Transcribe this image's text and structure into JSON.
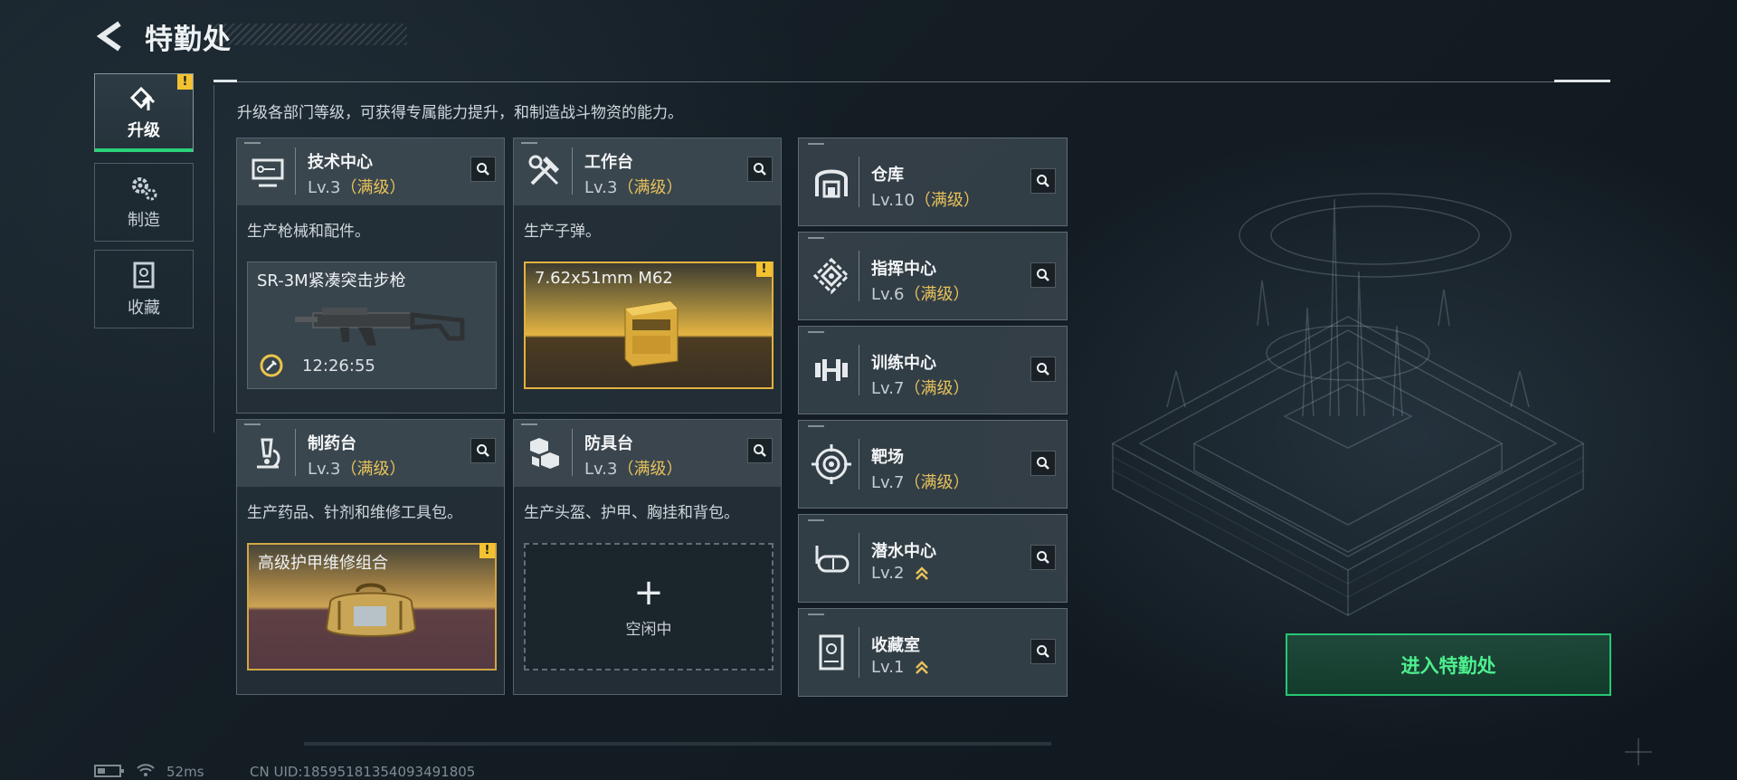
{
  "header": {
    "title": "特勤处"
  },
  "sidebar": {
    "tabs": [
      {
        "label": "升级",
        "icon": "upgrade-icon",
        "active": true,
        "alert": "!"
      },
      {
        "label": "制造",
        "icon": "gears-icon",
        "active": false
      },
      {
        "label": "收藏",
        "icon": "collection-icon",
        "active": false
      }
    ]
  },
  "description": "升级各部门等级，可获得专属能力提升，和制造战斗物资的能力。",
  "workshops": [
    {
      "name": "技术中心",
      "level": "Lv.3",
      "status": "（满级）",
      "desc": "生产枪械和配件。",
      "icon": "monitor-icon",
      "slot": {
        "item": "SR-3M紧凑突击步枪",
        "timer": "12:26:55",
        "icon": "timer-icon"
      }
    },
    {
      "name": "工作台",
      "level": "Lv.3",
      "status": "（满级）",
      "desc": "生产子弹。",
      "icon": "tools-icon",
      "slot": {
        "item": "7.62x51mm M62",
        "alert": "!"
      }
    },
    {
      "name": "制药台",
      "level": "Lv.3",
      "status": "（满级）",
      "desc": "生产药品、针剂和维修工具包。",
      "icon": "microscope-icon",
      "slot": {
        "item": "高级护甲维修组合",
        "alert": "!"
      }
    },
    {
      "name": "防具台",
      "level": "Lv.3",
      "status": "（满级）",
      "desc": "生产头盔、护甲、胸挂和背包。",
      "icon": "armor-icon",
      "slot": {
        "plus": "+",
        "idle": "空闲中"
      }
    }
  ],
  "facilities": [
    {
      "name": "仓库",
      "level": "Lv.10",
      "status": "（满级）",
      "icon": "warehouse-icon"
    },
    {
      "name": "指挥中心",
      "level": "Lv.6",
      "status": "（满级）",
      "icon": "command-icon"
    },
    {
      "name": "训练中心",
      "level": "Lv.7",
      "status": "（满级）",
      "icon": "dumbbell-icon"
    },
    {
      "name": "靶场",
      "level": "Lv.7",
      "status": "（满级）",
      "icon": "target-icon"
    },
    {
      "name": "潜水中心",
      "level": "Lv.2",
      "upgradable": true,
      "icon": "diving-mask-icon"
    },
    {
      "name": "收藏室",
      "level": "Lv.1",
      "upgradable": true,
      "icon": "collection-room-icon"
    }
  ],
  "enter_button": "进入特勤处",
  "footer": {
    "ping": "52ms",
    "uid": "CN UID:18595181354093491805"
  },
  "colors": {
    "accent_green": "#2bd27a",
    "max_level_gold": "#e8c25a",
    "alert_yellow": "#f2c230"
  }
}
